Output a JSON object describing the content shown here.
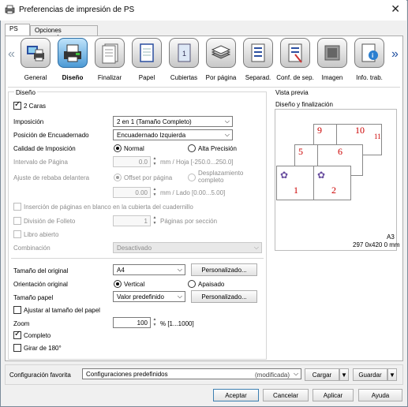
{
  "window": {
    "title": "Preferencias de impresión de PS",
    "close_glyph": "✕"
  },
  "tabs": [
    {
      "label": "PS"
    },
    {
      "label": "Opciones avanzadas"
    }
  ],
  "toolbar": {
    "items": [
      {
        "label": "General",
        "icon": "printer-computer-icon"
      },
      {
        "label": "Diseño",
        "icon": "printer-layout-icon"
      },
      {
        "label": "Finalizar",
        "icon": "finishing-icon"
      },
      {
        "label": "Papel",
        "icon": "paper-icon"
      },
      {
        "label": "Cubiertas",
        "icon": "cover-icon"
      },
      {
        "label": "Por página",
        "icon": "per-page-icon"
      },
      {
        "label": "Separad.",
        "icon": "separator-icon"
      },
      {
        "label": "Conf. de sep.",
        "icon": "separator-settings-icon"
      },
      {
        "label": "Imagen",
        "icon": "image-icon"
      },
      {
        "label": "Info. trab.",
        "icon": "job-info-icon"
      }
    ],
    "active_index": 1
  },
  "layout": {
    "group_title": "Diseño",
    "duplex": {
      "label": "2 Caras",
      "checked": true
    },
    "imposition": {
      "label": "Imposición",
      "value": "2 en 1 (Tamaño Completo)"
    },
    "binding": {
      "label": "Posición de Encuadernado",
      "value": "Encuadernado Izquierda"
    },
    "quality": {
      "label": "Calidad de Imposición",
      "opt1": "Normal",
      "opt2": "Alta Precisión"
    },
    "page_interval": {
      "label": "Intervalo de Página",
      "value": "0.0",
      "unit": "mm / Hoja [-250.0...250.0]"
    },
    "front_trim": {
      "label": "Ajuste de rebaba delantera",
      "opt1": "Offset por página",
      "opt2": "Desplazamiento completo",
      "value": "0.00",
      "unit": "mm / Lado [0.00...5.00]"
    },
    "blank_insert": {
      "label": "Inserción de páginas en blanco en la cubierta del cuadernillo"
    },
    "booklet_split": {
      "label": "División de Folleto",
      "value": "1",
      "unit": "Páginas por sección"
    },
    "open_book": {
      "label": "Libro abierto"
    },
    "combination": {
      "label": "Combinación",
      "value": "Desactivado"
    },
    "original_size": {
      "label": "Tamaño del original",
      "value": "A4",
      "button": "Personalizado..."
    },
    "orientation": {
      "label": "Orientación original",
      "opt1": "Vertical",
      "opt2": "Apaisado"
    },
    "paper_size": {
      "label": "Tamaño papel",
      "value": "Valor predefinido",
      "button": "Personalizado..."
    },
    "fit_paper": {
      "label": "Ajustar al tamaño del papel",
      "checked": false
    },
    "zoom": {
      "label": "Zoom",
      "value": "100",
      "unit": "% [1...1000]"
    },
    "complete": {
      "label": "Completo",
      "checked": true
    },
    "rotate": {
      "label": "Girar de 180°",
      "checked": false
    }
  },
  "preview": {
    "title": "Vista previa",
    "subtitle": "Diseño y finalización",
    "page_numbers": [
      "1",
      "2",
      "5",
      "6",
      "9",
      "10",
      "11"
    ],
    "size_name": "A3",
    "size_dims": "297 0x420 0 mm"
  },
  "favorites": {
    "label": "Configuración favorita",
    "value": "Configuraciones predefinidos",
    "modified": "(modificada)",
    "load": "Cargar",
    "save": "Guardar"
  },
  "footer": {
    "ok": "Aceptar",
    "cancel": "Cancelar",
    "apply": "Aplicar",
    "help": "Ayuda"
  },
  "colors": {
    "accent": "#4c9ad5",
    "page_number": "#cc0000"
  }
}
